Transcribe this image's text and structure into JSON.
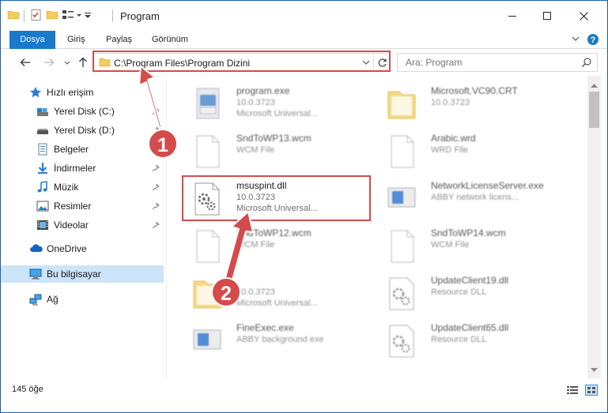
{
  "window": {
    "title": "Program",
    "controls": {
      "minimize": "minimize",
      "maximize": "maximize",
      "close": "close"
    }
  },
  "ribbon": {
    "tabs": [
      {
        "label": "Dosya"
      },
      {
        "label": "Giriş"
      },
      {
        "label": "Paylaş"
      },
      {
        "label": "Görünüm"
      }
    ]
  },
  "address": {
    "path": "C:\\Program Files\\Program Dizini"
  },
  "search": {
    "placeholder": "Ara: Program"
  },
  "nav": {
    "items": [
      {
        "label": "Hızlı erişim",
        "icon": "star-icon"
      },
      {
        "label": "Yerel Disk (C:)",
        "icon": "drive-icon",
        "pinned": true
      },
      {
        "label": "Yerel Disk (D:)",
        "icon": "drive-icon",
        "pinned": true
      },
      {
        "label": "Belgeler",
        "icon": "documents-icon",
        "pinned": true
      },
      {
        "label": "İndirmeler",
        "icon": "download-icon",
        "pinned": true
      },
      {
        "label": "Müzik",
        "icon": "music-icon",
        "pinned": true
      },
      {
        "label": "Resimler",
        "icon": "pictures-icon",
        "pinned": true
      },
      {
        "label": "Videolar",
        "icon": "videos-icon",
        "pinned": true
      },
      {
        "label": "OneDrive",
        "icon": "onedrive-icon"
      },
      {
        "label": "Bu bilgisayar",
        "icon": "computer-icon",
        "selected": true
      },
      {
        "label": "Ağ",
        "icon": "network-icon"
      }
    ]
  },
  "files": [
    {
      "name": "program.exe",
      "line1": "10.0.3723",
      "line2": "Microsoft Universal...",
      "icon": "exe-icon"
    },
    {
      "name": "Microsoft.VC90.CRT",
      "line1": "10.0.3723",
      "line2": "",
      "icon": "folder-icon"
    },
    {
      "name": "SndToWP13.wcm",
      "line1": "WCM File",
      "line2": "",
      "icon": "file-icon"
    },
    {
      "name": "Arabic.wrd",
      "line1": "WRD File",
      "line2": "",
      "icon": "file-icon"
    },
    {
      "name": "msuspint.dll",
      "line1": "10.0.3723",
      "line2": "Microsoft Universal...",
      "icon": "dll-icon"
    },
    {
      "name": "NetworkLicenseServer.exe",
      "line1": "ABBY network licens...",
      "line2": "",
      "icon": "app-icon"
    },
    {
      "name": "SndToWP12.wcm",
      "line1": "WCM File",
      "line2": "",
      "icon": "file-icon"
    },
    {
      "name": "SndToWP14.wcm",
      "line1": "WCM File",
      "line2": "",
      "icon": "file-icon"
    },
    {
      "name": "",
      "line1": "10.0.3723",
      "line2": "Microsoft Universal...",
      "icon": "folder-icon"
    },
    {
      "name": "UpdateClient19.dll",
      "line1": "Resource DLL",
      "line2": "",
      "icon": "dll-icon"
    },
    {
      "name": "FineExec.exe",
      "line1": "ABBY background exe",
      "line2": "",
      "icon": "app-icon"
    },
    {
      "name": "UpdateClient65.dll",
      "line1": "Resource DLL",
      "line2": "",
      "icon": "dll-icon"
    }
  ],
  "status": {
    "count": "145 öğe"
  },
  "annotations": {
    "step1": "1",
    "step2": "2",
    "color": "#d44b4b"
  },
  "colors": {
    "accent": "#1979ca",
    "selection": "#cce4f7"
  }
}
